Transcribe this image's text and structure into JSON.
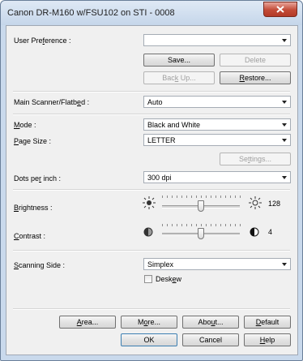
{
  "window": {
    "title": "Canon DR-M160 w/FSU102 on STI - 0008"
  },
  "user_preference": {
    "label_pre": "User Pre",
    "label_u": "f",
    "label_post": "erence :",
    "value": "",
    "save_pre": "",
    "save_u": "",
    "save_post": "Save...",
    "delete": "Delete",
    "backup_pre": "Bac",
    "backup_u": "k",
    "backup_post": " Up...",
    "restore_pre": "",
    "restore_u": "R",
    "restore_post": "estore..."
  },
  "main_scanner": {
    "label_pre": "Main Scanner/Flatb",
    "label_u": "e",
    "label_post": "d :",
    "value": "Auto"
  },
  "mode": {
    "label_pre": "",
    "label_u": "M",
    "label_post": "ode :",
    "value": "Black and White"
  },
  "page_size": {
    "label_pre": "",
    "label_u": "P",
    "label_post": "age Size :",
    "value": "LETTER",
    "settings_pre": "Se",
    "settings_u": "t",
    "settings_post": "tings..."
  },
  "dpi": {
    "label_pre": "Dots pe",
    "label_u": "r",
    "label_post": " inch :",
    "value": "300 dpi"
  },
  "brightness": {
    "label_pre": "",
    "label_u": "B",
    "label_post": "rightness :",
    "value": "128",
    "level": 0.5
  },
  "contrast": {
    "label_pre": "",
    "label_u": "C",
    "label_post": "ontrast :",
    "value": "4",
    "level": 0.5
  },
  "scanning_side": {
    "label_pre": "",
    "label_u": "S",
    "label_post": "canning Side :",
    "value": "Simplex",
    "deskew_pre": "Desk",
    "deskew_u": "e",
    "deskew_post": "w",
    "deskew_checked": false
  },
  "buttons": {
    "area_pre": "",
    "area_u": "A",
    "area_post": "rea...",
    "more_pre": "M",
    "more_u": "o",
    "more_post": "re...",
    "about_pre": "Abo",
    "about_u": "u",
    "about_post": "t...",
    "default_pre": "",
    "default_u": "D",
    "default_post": "efault",
    "ok": "OK",
    "cancel": "Cancel",
    "help_pre": "",
    "help_u": "H",
    "help_post": "elp"
  }
}
